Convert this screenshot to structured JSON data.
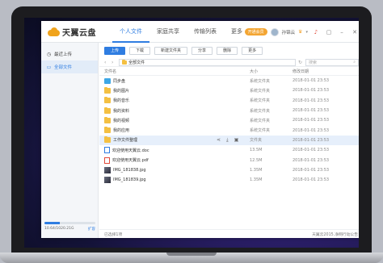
{
  "app": {
    "logo_text": "天翼云盘",
    "nav_tabs": [
      "个人文件",
      "家庭共享",
      "传输列表",
      "更多"
    ],
    "member_button": "开通会员",
    "username": "孙锦云"
  },
  "sidebar": {
    "items": [
      {
        "label": "最近上传",
        "icon": "clock-icon"
      },
      {
        "label": "全部文件",
        "icon": "folder-icon"
      }
    ],
    "quota": {
      "used_text": "10.64/1020.21G",
      "expand_label": "扩容",
      "used_fraction": 0.0104
    }
  },
  "toolbar": {
    "upload": "上传",
    "download": "下载",
    "new_folder": "新建文件夹",
    "share": "分享",
    "delete": "删除",
    "more": "更多"
  },
  "path": {
    "current": "全部文件",
    "search_placeholder": "搜索"
  },
  "table": {
    "headers": {
      "name": "文件名",
      "size": "大小",
      "date": "修改日期"
    },
    "rows": [
      {
        "name": "同步盘",
        "size": "系统文件夹",
        "date": "2018-01-01 23:53",
        "type": "sync"
      },
      {
        "name": "我的图片",
        "size": "系统文件夹",
        "date": "2018-01-01 23:53",
        "type": "folder"
      },
      {
        "name": "我的音乐",
        "size": "系统文件夹",
        "date": "2018-01-01 23:53",
        "type": "folder"
      },
      {
        "name": "我的资料",
        "size": "系统文件夹",
        "date": "2018-01-01 23:53",
        "type": "folder"
      },
      {
        "name": "我的视频",
        "size": "系统文件夹",
        "date": "2018-01-01 23:53",
        "type": "folder"
      },
      {
        "name": "我的应用",
        "size": "系统文件夹",
        "date": "2018-01-01 23:53",
        "type": "folder"
      },
      {
        "name": "工作文件整理",
        "size": "文件夹",
        "date": "2018-01-01 23:53",
        "type": "folder",
        "selected": true
      },
      {
        "name": "欢迎使用天翼云.doc",
        "size": "13.5M",
        "date": "2018-01-01 23:53",
        "type": "doc"
      },
      {
        "name": "欢迎使用天翼云.pdf",
        "size": "12.5M",
        "date": "2018-01-01 23:53",
        "type": "pdf"
      },
      {
        "name": "IMG_181838.jpg",
        "size": "1.35M",
        "date": "2018-01-01 23:53",
        "type": "img"
      },
      {
        "name": "IMG_181839.jpg",
        "size": "1.35M",
        "date": "2018-01-01 23:53",
        "type": "img"
      }
    ]
  },
  "statusbar": {
    "left": "已选择1项",
    "right": "天翼云2015.净网行动公告"
  },
  "colors": {
    "accent": "#2f7de1",
    "member": "#f3a532",
    "folder": "#f4c042"
  }
}
